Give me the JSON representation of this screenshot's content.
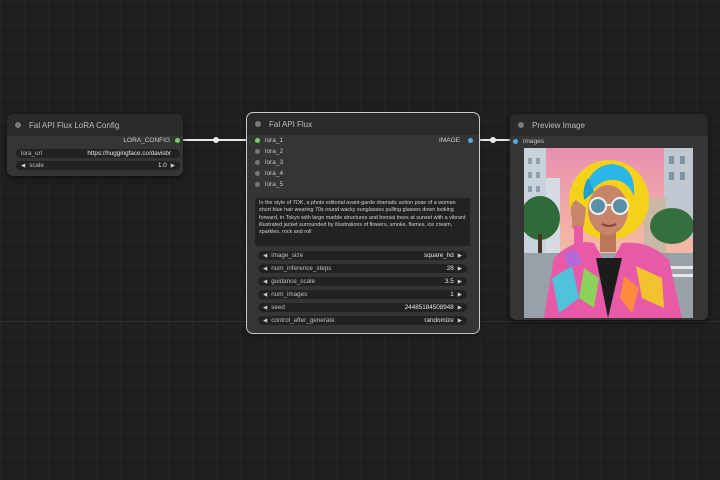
{
  "nodes": {
    "lora_config": {
      "title": "Fal API Flux LoRA Config",
      "output_label": "LORA_CONFIG",
      "lora_url_label": "lora_url",
      "lora_url_value": "https://huggingface.co/davisbr",
      "scale_label": "scale",
      "scale_value": "1.0"
    },
    "flux": {
      "title": "Fal API Flux",
      "inputs": [
        "lora_1",
        "lora_2",
        "lora_3",
        "lora_4",
        "lora_5"
      ],
      "output_label": "IMAGE",
      "prompt": "In the style of TOK, a photo editorial avant-garde dramatic action pose of a woman short blue hair wearing 70s round wacky sunglasses pulling glasses down looking forward, in Tokyo with large marble structures and bonsai trees at sunset with a vibrant illustrated jacket surrounded by illustrations of flowers, smoke, flames, ice cream, sparkles, rock and roll",
      "params": [
        {
          "label": "image_size",
          "value": "square_hd"
        },
        {
          "label": "num_inference_steps",
          "value": "28"
        },
        {
          "label": "guidance_scale",
          "value": "3.5"
        },
        {
          "label": "num_images",
          "value": "1"
        },
        {
          "label": "seed",
          "value": "2448518450894​8"
        },
        {
          "label": "control_after_generate",
          "value": "randomize"
        }
      ]
    },
    "preview": {
      "title": "Preview Image",
      "input_label": "images",
      "image_alt_icon": "generated-image"
    }
  },
  "colors": {
    "canvas": "#1f1f20",
    "node_body": "#353535",
    "node_title": "#2a2a2a",
    "lora_slot": "#6fd35f",
    "image_slot": "#5aa8e6"
  }
}
